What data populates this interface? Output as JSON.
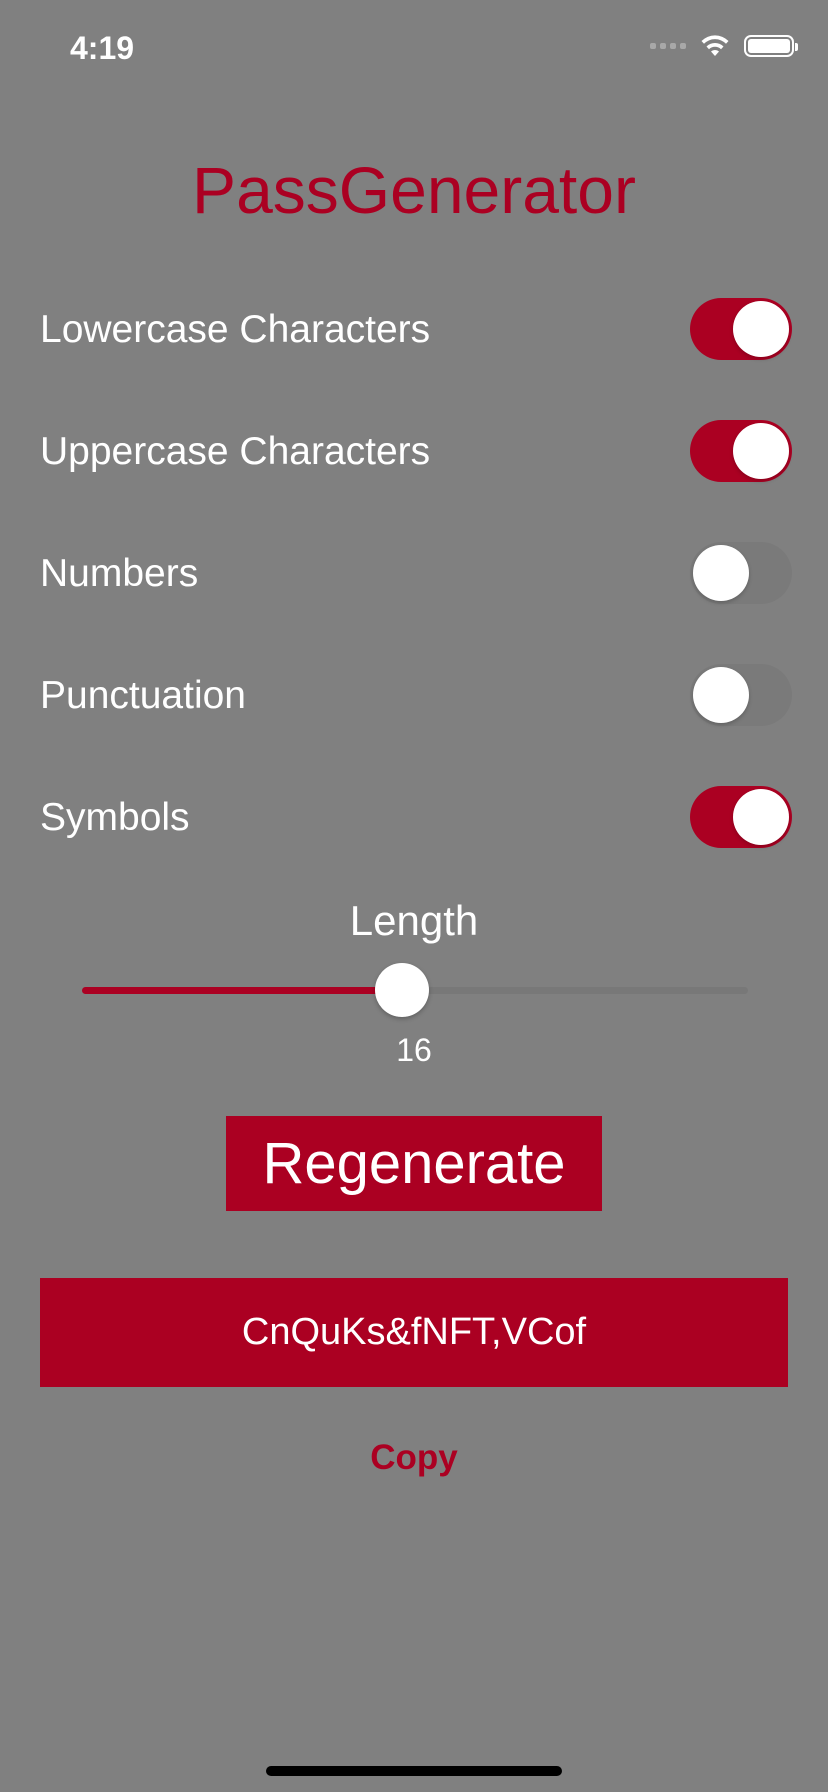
{
  "status_bar": {
    "time": "4:19",
    "icons": [
      "cellular-signal-icon",
      "wifi-icon",
      "battery-icon"
    ]
  },
  "app": {
    "title": "PassGenerator",
    "accent_color": "#ab0022",
    "background_color": "#808080"
  },
  "options": [
    {
      "label": "Lowercase Characters",
      "enabled": true
    },
    {
      "label": "Uppercase Characters",
      "enabled": true
    },
    {
      "label": "Numbers",
      "enabled": false
    },
    {
      "label": "Punctuation",
      "enabled": false
    },
    {
      "label": "Symbols",
      "enabled": true
    }
  ],
  "length": {
    "label": "Length",
    "value": "16",
    "slider_fraction": 0.48
  },
  "actions": {
    "regenerate_label": "Regenerate",
    "copy_label": "Copy"
  },
  "password": {
    "value": "CnQuKs&fNFT,VCof"
  }
}
